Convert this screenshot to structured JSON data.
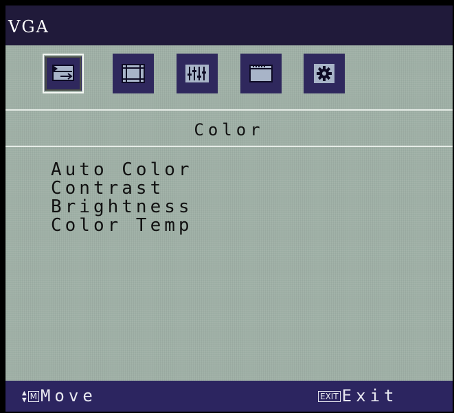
{
  "window": {
    "title": "VGA"
  },
  "iconbar": {
    "icons": [
      {
        "name": "color-icon",
        "selected": true
      },
      {
        "name": "image-position-icon",
        "selected": false
      },
      {
        "name": "equalizer-icon",
        "selected": false
      },
      {
        "name": "osd-settings-icon",
        "selected": false
      },
      {
        "name": "gear-icon",
        "selected": false
      }
    ]
  },
  "section": {
    "title": "Color"
  },
  "menu": {
    "items": [
      {
        "label": "Auto Color"
      },
      {
        "label": "Contrast"
      },
      {
        "label": "Brightness"
      },
      {
        "label": "Color Temp"
      }
    ]
  },
  "footer": {
    "menu_key": "M",
    "move_label": "Move",
    "exit_key": "EXIT",
    "exit_label": "Exit"
  },
  "colors": {
    "background": "#9fb0a6",
    "bar": "#2c2560",
    "title_bar": "#201a3a",
    "icon_tile": "#2f285d",
    "text": "#111111"
  }
}
